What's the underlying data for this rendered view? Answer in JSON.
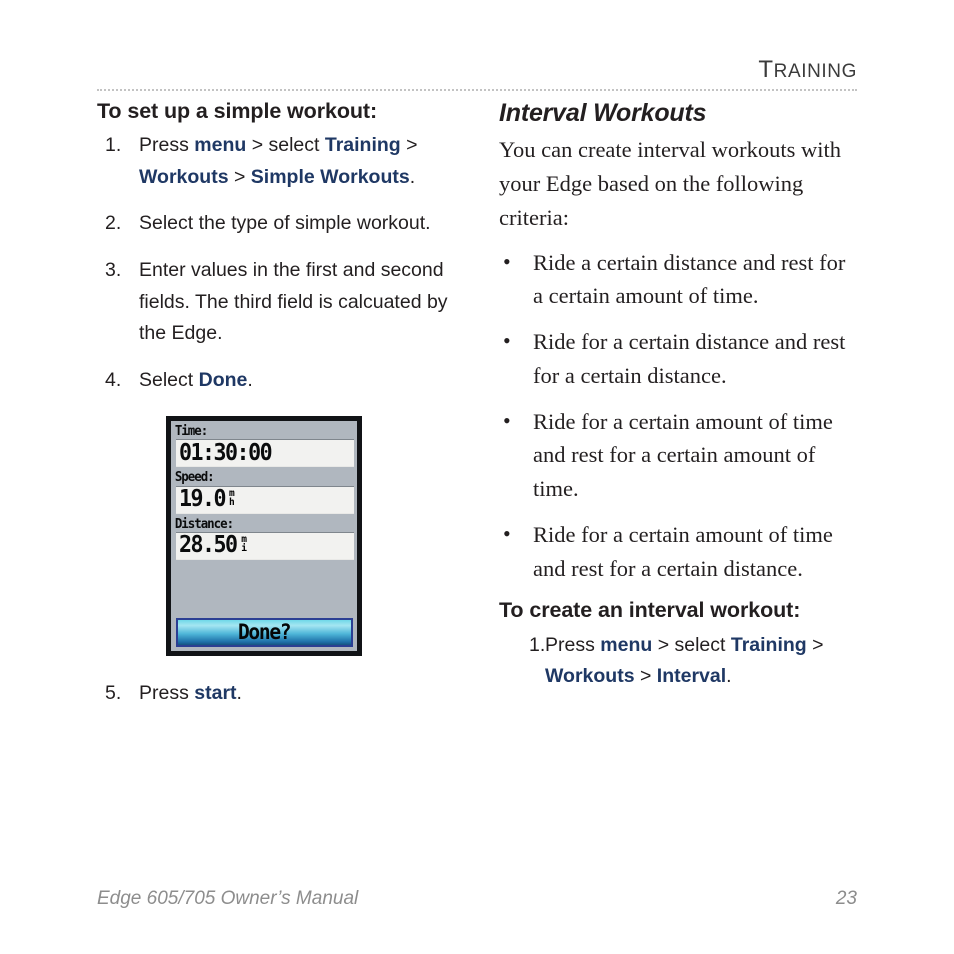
{
  "header": {
    "title_first_letter": "T",
    "title_rest": "RAINING",
    "title_full": "TRAINING"
  },
  "colors": {
    "ui_term_navy": "#1f3864",
    "body_text": "#231f20",
    "footer_gray": "#8d8d8d",
    "rule_gray": "#c3c3c3",
    "device_bezel": "#111316",
    "device_background": "#b0b7bf",
    "device_field_fill": "#f2f2f0",
    "device_button_border": "#2b3f93",
    "device_button_gradient_top": "#a5e6f2",
    "device_button_gradient_bottom": "#14537f"
  },
  "left_column": {
    "heading": "To set up a simple workout:",
    "steps": [
      {
        "number": "1.",
        "segments": [
          {
            "text": "Press ",
            "style": "plain"
          },
          {
            "text": "menu",
            "style": "ui"
          },
          {
            "text": " > select ",
            "style": "plain"
          },
          {
            "text": "Training",
            "style": "ui"
          },
          {
            "text": " > ",
            "style": "plain"
          },
          {
            "text": "Workouts",
            "style": "ui"
          },
          {
            "text": " > ",
            "style": "plain"
          },
          {
            "text": "Simple Workouts",
            "style": "ui"
          },
          {
            "text": ".",
            "style": "plain"
          }
        ],
        "plain_text": "Press menu > select Training > Workouts > Simple Workouts."
      },
      {
        "number": "2.",
        "segments": [
          {
            "text": "Select the type of simple workout.",
            "style": "plain"
          }
        ],
        "plain_text": "Select the type of simple workout."
      },
      {
        "number": "3.",
        "segments": [
          {
            "text": "Enter values in the first and second fields. The third field is calcuated by the Edge.",
            "style": "plain"
          }
        ],
        "plain_text": "Enter values in the first and second fields. The third field is calcuated by the Edge."
      },
      {
        "number": "4.",
        "segments": [
          {
            "text": "Select ",
            "style": "plain"
          },
          {
            "text": "Done",
            "style": "ui"
          },
          {
            "text": ".",
            "style": "plain"
          }
        ],
        "plain_text": "Select Done."
      }
    ],
    "final_step": {
      "number": "5.",
      "segments": [
        {
          "text": "Press ",
          "style": "plain"
        },
        {
          "text": "start",
          "style": "ui"
        },
        {
          "text": ".",
          "style": "plain"
        }
      ],
      "plain_text": "Press start."
    }
  },
  "device_screenshot": {
    "fields": [
      {
        "label": "Time:",
        "value": "01:30:00",
        "unit_top": "",
        "unit_bottom": ""
      },
      {
        "label": "Speed:",
        "value": "19.0",
        "unit_top": "m",
        "unit_bottom": "h"
      },
      {
        "label": "Distance:",
        "value": "28.50",
        "unit_top": "m",
        "unit_bottom": "i"
      }
    ],
    "button_label": "Done?"
  },
  "right_column": {
    "heading": "Interval Workouts",
    "intro": "You can create interval workouts with your Edge based on the following criteria:",
    "bullets": [
      "Ride a certain distance and rest for a certain amount of time.",
      "Ride for a certain distance and rest for a certain distance.",
      "Ride for a certain amount of time and rest for a certain amount of time.",
      "Ride for a certain amount of time and rest for a certain distance."
    ],
    "subheading": "To create an interval workout:",
    "steps": [
      {
        "number": "1.",
        "segments": [
          {
            "text": "Press ",
            "style": "plain"
          },
          {
            "text": "menu",
            "style": "ui"
          },
          {
            "text": " > select ",
            "style": "plain"
          },
          {
            "text": "Training",
            "style": "ui"
          },
          {
            "text": " > ",
            "style": "plain"
          },
          {
            "text": "Workouts",
            "style": "ui"
          },
          {
            "text": " > ",
            "style": "plain"
          },
          {
            "text": "Interval",
            "style": "ui"
          },
          {
            "text": ".",
            "style": "plain"
          }
        ],
        "plain_text": "Press menu > select Training > Workouts > Interval."
      }
    ]
  },
  "footer": {
    "manual_title": "Edge 605/705 Owner’s Manual",
    "page_number": "23"
  }
}
